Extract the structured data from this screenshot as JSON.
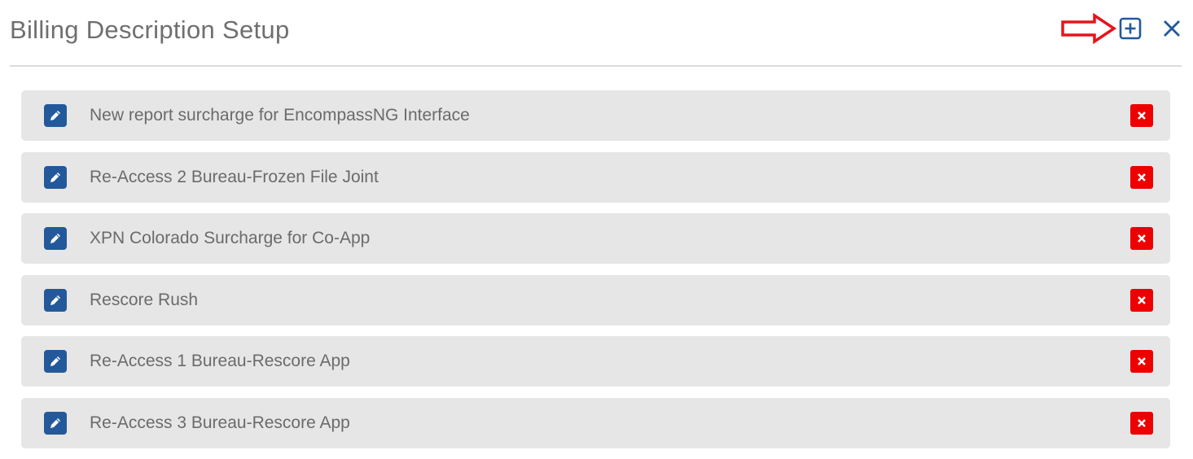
{
  "dialog": {
    "title": "Billing Description Setup",
    "accent_color": "#23599b",
    "danger_color": "#ee0000",
    "annotation_color": "#e8141c"
  },
  "toolbar": {
    "add_icon": "plus-square-icon",
    "close_icon": "close-icon",
    "annotation": "red-arrow-pointing-right"
  },
  "items": [
    {
      "label": "New report surcharge for EncompassNG Interface"
    },
    {
      "label": "Re-Access 2 Bureau-Frozen File Joint"
    },
    {
      "label": "XPN Colorado Surcharge for Co-App"
    },
    {
      "label": "Rescore Rush"
    },
    {
      "label": "Re-Access 1 Bureau-Rescore App"
    },
    {
      "label": "Re-Access 3 Bureau-Rescore App"
    }
  ]
}
